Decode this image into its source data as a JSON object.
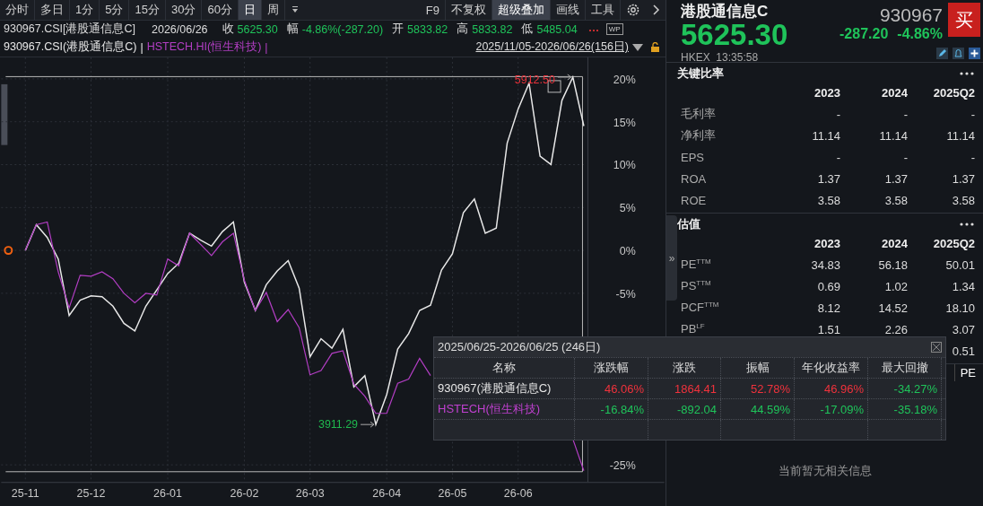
{
  "toolbar": {
    "periods": [
      {
        "label": "分时",
        "selected": false
      },
      {
        "label": "多日",
        "selected": false
      },
      {
        "label": "1分",
        "selected": false
      },
      {
        "label": "5分",
        "selected": false
      },
      {
        "label": "15分",
        "selected": false
      },
      {
        "label": "30分",
        "selected": false
      },
      {
        "label": "60分",
        "selected": false
      },
      {
        "label": "日",
        "selected": true
      },
      {
        "label": "周",
        "selected": false
      }
    ],
    "tools": [
      {
        "label": "F9",
        "selected": false
      },
      {
        "label": "不复权",
        "selected": false
      },
      {
        "label": "超级叠加",
        "selected": true
      },
      {
        "label": "画线",
        "selected": false
      },
      {
        "label": "工具",
        "selected": false
      }
    ]
  },
  "quote_line": {
    "name": "930967.CSI[港股通信息C]",
    "date": "2026/06/26",
    "fields": [
      {
        "label": "收",
        "value": "5625.30",
        "up": false
      },
      {
        "label": "幅",
        "value": "-4.86%(-287.20)",
        "up": false
      },
      {
        "label": "开",
        "value": "5833.82",
        "up": false
      },
      {
        "label": "高",
        "value": "5833.82",
        "up": false
      },
      {
        "label": "低",
        "value": "5485.04",
        "up": false
      }
    ],
    "badge": "WP"
  },
  "overlay_legend": {
    "separators": [
      "|",
      "|"
    ],
    "range": "2025/11/05-2026/06/26(156日)"
  },
  "chart": {
    "chart_data": {
      "type": "line",
      "categories": [
        "25-11",
        null,
        null,
        null,
        null,
        null,
        "25-12",
        null,
        null,
        null,
        null,
        null,
        null,
        "26-01",
        null,
        null,
        null,
        null,
        null,
        null,
        "26-02",
        null,
        null,
        null,
        null,
        null,
        "26-03",
        null,
        null,
        null,
        null,
        null,
        null,
        "26-04",
        null,
        null,
        null,
        null,
        null,
        "26-05",
        null,
        null,
        null,
        null,
        null,
        "26-06",
        null,
        null,
        null,
        null,
        null,
        null
      ],
      "series": [
        {
          "name": "930967.CSI(港股通信息C)",
          "color": "#e8e8e8",
          "values": [
            0,
            3,
            1.5,
            -1,
            -7.6,
            -5.8,
            -5.3,
            -5.4,
            -6.5,
            -8.5,
            -9.4,
            -6.5,
            -4.6,
            -2.7,
            -1.5,
            2,
            1.2,
            0.5,
            2.2,
            3.3,
            -3.7,
            -7,
            -4,
            -2.4,
            -1.2,
            -4.4,
            -12.4,
            -10.3,
            -11.4,
            -9.2,
            -15.9,
            -14.6,
            -20.3,
            -16.8,
            -11.5,
            -9.7,
            -7,
            -6.4,
            -2.3,
            -0.4,
            4.4,
            6,
            2,
            2.6,
            12.5,
            16.5,
            19.5,
            11,
            10,
            17.5,
            20.2,
            14.5
          ]
        },
        {
          "name": "HSTECH.HI(恒生科技)",
          "color": "#b33ec4",
          "values": [
            0,
            3,
            3.3,
            -2.5,
            -6.7,
            -2.9,
            -3,
            -2.5,
            -3.3,
            -5,
            -6.1,
            -5,
            -5.2,
            -1,
            -1.8,
            2,
            0.7,
            -0.6,
            1,
            2,
            -3.5,
            -7,
            -4.9,
            -8.3,
            -6.9,
            -9,
            -14.5,
            -14,
            -12,
            -11.7,
            -15.6,
            -17,
            -19,
            -19,
            -15.5,
            -15,
            -12.6,
            -14.6,
            null,
            null,
            null,
            null,
            null,
            null,
            null,
            null,
            null,
            null,
            null,
            null,
            -22,
            -25.7
          ]
        }
      ],
      "ylim": [
        -27,
        22.5
      ],
      "grid": true,
      "yticks": [
        {
          "value": 20,
          "label": "20%"
        },
        {
          "value": 15,
          "label": "15%"
        },
        {
          "value": 10,
          "label": "10%"
        },
        {
          "value": 5,
          "label": "5%"
        },
        {
          "value": 0,
          "label": "0%"
        },
        {
          "value": -5,
          "label": "-5%"
        },
        {
          "value": -25,
          "label": "-25%"
        }
      ],
      "annotations": [
        "5912.50",
        "3911.29"
      ]
    }
  },
  "stats": {
    "title": "2025/06/25-2026/06/25 (246日)",
    "columns": [
      "名称",
      "涨跌幅",
      "涨跌",
      "振幅",
      "年化收益率",
      "最大回撤"
    ],
    "rows": [
      {
        "color": "#e6e6e6",
        "cells": [
          {
            "text": "930967(港股通信息C)"
          },
          {
            "text": "46.06%",
            "up": true
          },
          {
            "text": "1864.41",
            "up": true
          },
          {
            "text": "52.78%",
            "up": true
          },
          {
            "text": "46.96%",
            "up": true
          },
          {
            "text": "-34.27%",
            "up": false
          }
        ]
      },
      {
        "color": "#c040d0",
        "cells": [
          {
            "text": "HSTECH(恒生科技)"
          },
          {
            "text": "-16.84%",
            "up": false
          },
          {
            "text": "-892.04",
            "up": false
          },
          {
            "text": "44.59%",
            "up": false
          },
          {
            "text": "-17.09%",
            "up": false
          },
          {
            "text": "-35.18%",
            "up": false
          }
        ]
      }
    ]
  },
  "quote": {
    "name": "港股通信息C",
    "code": "930967",
    "price": "5625.30",
    "change": "-287.20",
    "change_pct": "-4.86%",
    "up": false,
    "exchange": "HKEX",
    "time": "13:35:58",
    "buy_label": "买"
  },
  "key_ratios": {
    "title": "关键比率",
    "columns": [
      "2023",
      "2024",
      "2025Q2"
    ],
    "rows": [
      {
        "label": "毛利率",
        "values": [
          "-",
          "-",
          "-"
        ]
      },
      {
        "label": "净利率",
        "values": [
          "11.14",
          "11.14",
          "11.14"
        ]
      },
      {
        "label": "EPS",
        "values": [
          "-",
          "-",
          "-"
        ]
      },
      {
        "label": "ROA",
        "values": [
          "1.37",
          "1.37",
          "1.37"
        ]
      },
      {
        "label": "ROE",
        "values": [
          "3.58",
          "3.58",
          "3.58"
        ]
      }
    ]
  },
  "valuation": {
    "title": "估值",
    "columns": [
      "2023",
      "2024",
      "2025Q2"
    ],
    "rows": [
      {
        "label": "PE$^{TTM}$",
        "values": [
          "34.83",
          "56.18",
          "50.01"
        ]
      },
      {
        "label": "PS$^{TTM}$",
        "values": [
          "0.69",
          "1.02",
          "1.34"
        ]
      },
      {
        "label": "PCF$^{TTM}$",
        "values": [
          "8.12",
          "14.52",
          "18.10"
        ]
      },
      {
        "label": "PB$^{LF}$",
        "values": [
          "1.51",
          "2.26",
          "3.07"
        ]
      },
      {
        "last_value": "0.51"
      }
    ]
  },
  "collapse_glyph": "»",
  "bottom_tabs": [
    {
      "label": "PE",
      "selected": true
    }
  ],
  "news": {
    "empty_text": "当前暂无相关信息"
  }
}
